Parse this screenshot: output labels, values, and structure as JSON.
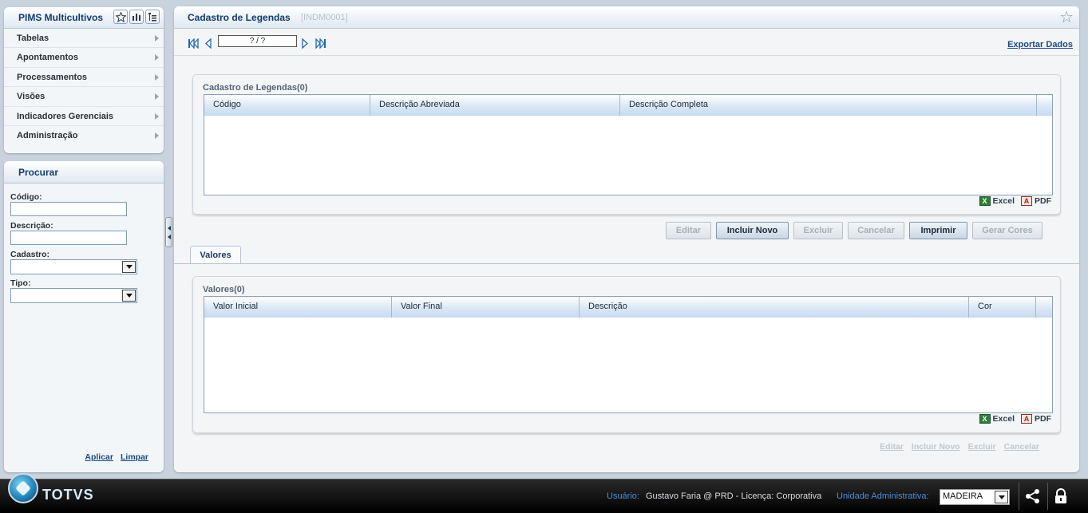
{
  "sidebar": {
    "app_title": "PIMS Multicultivos",
    "items": [
      {
        "label": "Tabelas"
      },
      {
        "label": "Apontamentos"
      },
      {
        "label": "Processamentos"
      },
      {
        "label": "Visões"
      },
      {
        "label": "Indicadores Gerenciais"
      },
      {
        "label": "Administração"
      }
    ]
  },
  "search": {
    "title": "Procurar",
    "codigo_label": "Código:",
    "codigo_value": "",
    "descricao_label": "Descrição:",
    "descricao_value": "",
    "cadastro_label": "Cadastro:",
    "cadastro_value": "",
    "tipo_label": "Tipo:",
    "tipo_value": "",
    "apply_label": "Aplicar",
    "clear_label": "Limpar"
  },
  "main": {
    "title": "Cadastro de Legendas",
    "code": "[INDM0001]",
    "page_indicator": "? / ?",
    "export_label": "Exportar Dados",
    "legend_grid": {
      "title": "Cadastro de Legendas(0)",
      "columns": [
        "Código",
        "Descrição Abreviada",
        "Descrição Completa"
      ]
    },
    "values_grid": {
      "title": "Valores(0)",
      "columns": [
        "Valor Inicial",
        "Valor Final",
        "Descrição",
        "Cor"
      ]
    },
    "excel_label": "Excel",
    "pdf_label": "PDF",
    "buttons": {
      "editar": "Editar",
      "incluir_novo": "Incluir Novo",
      "excluir": "Excluir",
      "cancelar": "Cancelar",
      "imprimir": "Imprimir",
      "gerar_cores": "Gerar Cores"
    },
    "tab_label": "Valores",
    "bottom_actions": {
      "editar": "Editar",
      "incluir_novo": "Incluir Novo",
      "excluir": "Excluir",
      "cancelar": "Cancelar"
    }
  },
  "footer": {
    "brand": "TOTVS",
    "user_label": "Usuário:",
    "user_value": "Gustavo Faria @ PRD - Licença: Corporativa",
    "unit_label": "Unidade Administrativa:",
    "unit_value": "MADEIRA"
  },
  "icons": {
    "favorite": "star-icon",
    "chart": "bar-chart-icon",
    "tree": "tree-list-icon",
    "share": "share-icon",
    "lock": "lock-icon"
  },
  "colors": {
    "accent": "#123a6b",
    "link": "#1c4a86",
    "footer_label": "#4a8fe0"
  }
}
